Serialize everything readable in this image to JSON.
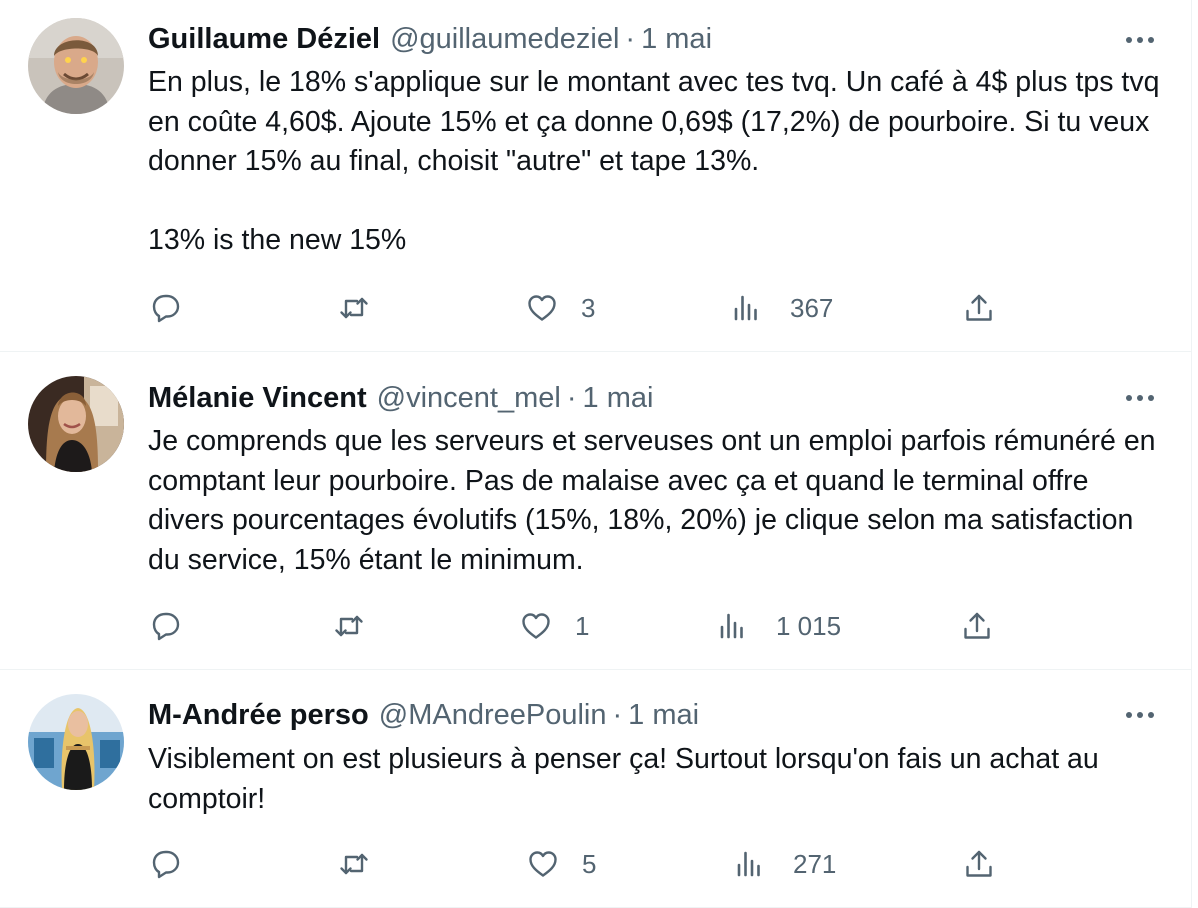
{
  "tweets": [
    {
      "name": "Guillaume Déziel",
      "handle": "@guillaumedeziel",
      "separator": "·",
      "time": "1 mai",
      "paragraphs": [
        "En plus, le 18% s'applique sur le montant avec tes tvq. Un café à 4$ plus tps tvq en coûte 4,60$. Ajoute 15% et ça donne 0,69$ (17,2%) de pourboire. Si tu veux donner 15% au final, choisit \"autre\" et tape 13%.",
        "13% is the new 15%"
      ],
      "likes": "3",
      "views": "367"
    },
    {
      "name": "Mélanie Vincent",
      "handle": "@vincent_mel",
      "separator": "·",
      "time": "1 mai",
      "paragraphs": [
        "Je comprends que les serveurs et serveuses ont un emploi parfois rémunéré en comptant leur pourboire. Pas de malaise avec ça et quand le terminal offre divers pourcentages évolutifs (15%, 18%, 20%) je clique selon ma satisfaction du service, 15% étant le minimum."
      ],
      "likes": "1",
      "views": "1 015"
    },
    {
      "name": "M-Andrée perso",
      "handle": "@MAndreePoulin",
      "separator": "·",
      "time": "1 mai",
      "paragraphs": [
        "Visiblement on est plusieurs à penser ça!  Surtout lorsqu'on fais un achat au comptoir!"
      ],
      "likes": "5",
      "views": "271"
    }
  ],
  "icons": {
    "reply": "reply-icon",
    "retweet": "retweet-icon",
    "like": "heart-icon",
    "views": "views-icon",
    "share": "share-icon",
    "more": "more-icon"
  },
  "colors": {
    "text": "#0f1419",
    "secondary": "#536471",
    "divider": "#eff3f4"
  }
}
